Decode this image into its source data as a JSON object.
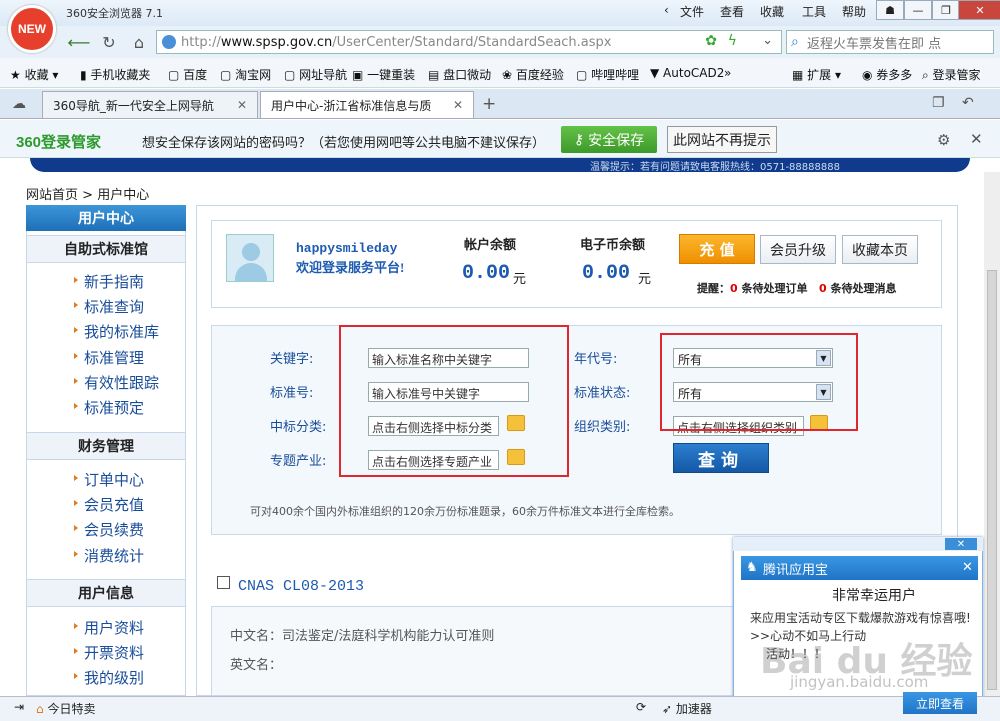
{
  "browser": {
    "logo_text": "NEW",
    "title": "360安全浏览器 7.1",
    "menu": [
      "文件",
      "查看",
      "收藏",
      "工具",
      "帮助"
    ],
    "url_scheme": "http://",
    "url_domain": "www.spsp.gov.cn",
    "url_path": "/UserCenter/Standard/StandardSeach.aspx",
    "search_text": "返程火车票发售在即 点",
    "favorites": [
      "收藏",
      "手机收藏夹",
      "百度",
      "淘宝网",
      "网址导航",
      "一键重装",
      "盘口微动",
      "百度经验",
      "哔哩哔哩",
      "AutoCAD2"
    ],
    "fav_right": [
      "扩展",
      "券多多",
      "登录管家"
    ],
    "tabs": [
      "360导航_新一代安全上网导航",
      "用户中心-浙江省标准信息与质"
    ],
    "password_bar": {
      "brand": "360登录管家",
      "prompt": "想安全保存该网站的密码吗？（若您使用网吧等公共电脑不建议保存）",
      "save_label": "安全保存",
      "never_label": "此网站不再提示"
    },
    "strip_text": "温馨提示：若有问题请致电客服热线：0571-88888888",
    "status_left": "今日特卖",
    "status_right": "加速器"
  },
  "breadcrumb": {
    "home": "网站首页",
    "sep": ">",
    "current": "用户中心"
  },
  "sidebar": {
    "header": "用户中心",
    "sections": [
      {
        "title": "自助式标准馆",
        "items": [
          "新手指南",
          "标准查询",
          "我的标准库",
          "标准管理",
          "有效性跟踪",
          "标准预定"
        ]
      },
      {
        "title": "财务管理",
        "items": [
          "订单中心",
          "会员充值",
          "会员续费",
          "消费统计"
        ]
      },
      {
        "title": "用户信息",
        "items": [
          "用户资料",
          "开票资料",
          "我的级别"
        ]
      }
    ]
  },
  "user": {
    "username": "happysmileday",
    "welcome": "欢迎登录服务平台!",
    "account_label": "帐户余额",
    "account_value": "0.00",
    "account_unit": "元",
    "ecoin_label": "电子币余额",
    "ecoin_value": "0.00",
    "ecoin_unit": "元",
    "recharge_label": "充 值",
    "upgrade_label": "会员升级",
    "bookmark_label": "收藏本页",
    "notice_prefix": "提醒：",
    "pending_orders_count": "0",
    "pending_orders_text": "条待处理订单",
    "pending_msgs_count": "0",
    "pending_msgs_text": "条待处理消息"
  },
  "search": {
    "keyword_label": "关键字:",
    "keyword_value": "输入标准名称中关键字",
    "stdno_label": "标准号:",
    "stdno_value": "输入标准号中关键字",
    "ccs_label": "中标分类:",
    "ccs_value": "点击右侧选择中标分类",
    "industry_label": "专题产业:",
    "industry_value": "点击右侧选择专题产业",
    "year_label": "年代号:",
    "year_value": "所有",
    "status_label": "标准状态:",
    "status_value": "所有",
    "org_label": "组织类别:",
    "org_value": "点击右侧选择组织类别",
    "query_label": "查询",
    "description": "可对400余个国内外标准组织的120余万份标准题录，60余万件标准文本进行全库检索。"
  },
  "result": {
    "code": "CNAS CL08-2013",
    "cn_label": "中文名：",
    "cn_value": "司法鉴定/法庭科学机构能力认可准则",
    "en_label": "英文名："
  },
  "popup": {
    "header": "腾讯应用宝",
    "title": "非常幸运用户",
    "line1": "来应用宝活动专区下载爆款游戏有惊喜哦!",
    "line2": ">>心动不如马上行动",
    "line3": "活动！！！",
    "view_label": "立即查看",
    "watermark": "Bai du 经验",
    "watermark_url": "jingyan.baidu.com"
  },
  "colors": {
    "accent": "#1d5bb0",
    "highlight": "#e0262e",
    "orange": "#f08f00"
  }
}
